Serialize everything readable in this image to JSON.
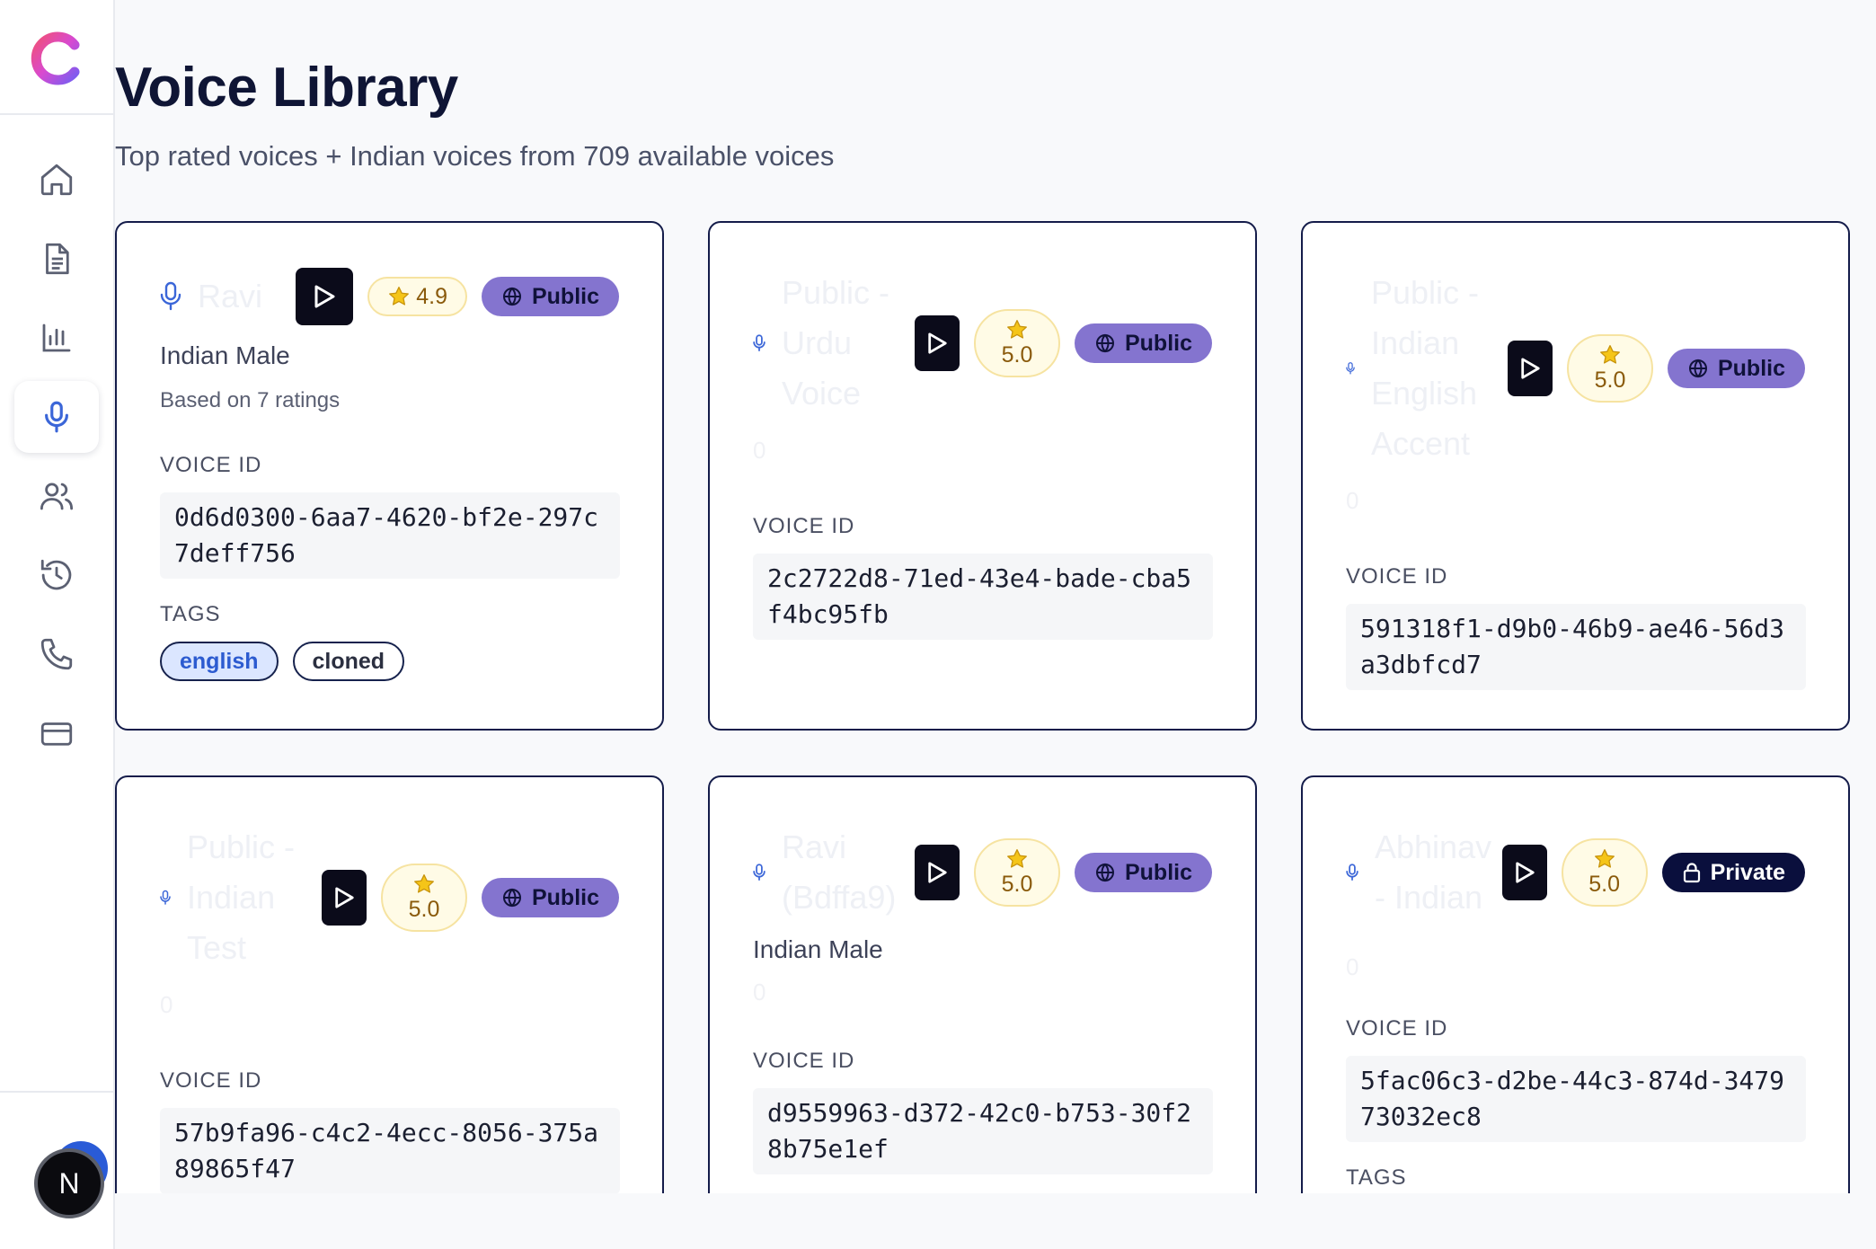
{
  "page": {
    "title": "Voice Library",
    "subtitle": "Top rated voices + Indian voices from 709 available voices"
  },
  "sidebar": {
    "items": [
      {
        "name": "home",
        "icon": "home-icon",
        "active": false
      },
      {
        "name": "documents",
        "icon": "document-icon",
        "active": false
      },
      {
        "name": "analytics",
        "icon": "bar-chart-icon",
        "active": false
      },
      {
        "name": "voices",
        "icon": "microphone-icon",
        "active": true
      },
      {
        "name": "users",
        "icon": "users-icon",
        "active": false
      },
      {
        "name": "history",
        "icon": "history-icon",
        "active": false
      },
      {
        "name": "calls",
        "icon": "phone-icon",
        "active": false
      },
      {
        "name": "billing",
        "icon": "credit-card-icon",
        "active": false
      }
    ],
    "user_initial": "N"
  },
  "labels": {
    "voice_id": "VOICE ID",
    "tags": "TAGS"
  },
  "cards": [
    {
      "name": "Ravi",
      "rating": "4.9",
      "visibility": "Public",
      "description": "Indian Male",
      "ratings_count": "Based on 7 ratings",
      "voice_id": "0d6d0300-6aa7-4620-bf2e-297c7deff756",
      "tags": [
        "english",
        "cloned"
      ]
    },
    {
      "name_lines": [
        "Public -",
        "Urdu",
        "Voice"
      ],
      "rating": "5.0",
      "visibility": "Public",
      "zero": "0",
      "voice_id": "2c2722d8-71ed-43e4-bade-cba5f4bc95fb"
    },
    {
      "name_lines": [
        "Public -",
        "Indian",
        "English",
        "Accent"
      ],
      "rating": "5.0",
      "visibility": "Public",
      "zero": "0",
      "voice_id": "591318f1-d9b0-46b9-ae46-56d3a3dbfcd7"
    },
    {
      "name_lines": [
        "Public -",
        "Indian",
        "Test"
      ],
      "rating": "5.0",
      "visibility": "Public",
      "zero": "0",
      "voice_id": "57b9fa96-c4c2-4ecc-8056-375a89865f47"
    },
    {
      "name_lines": [
        "Ravi",
        "(Bdffa9)"
      ],
      "rating": "5.0",
      "visibility": "Public",
      "description": "Indian Male",
      "zero": "0",
      "voice_id": "d9559963-d372-42c0-b753-30f28b75e1ef"
    },
    {
      "name_lines": [
        "Abhinav",
        "- Indian"
      ],
      "rating": "5.0",
      "visibility": "Private",
      "zero": "0",
      "voice_id": "5fac06c3-d2be-44c3-874d-347973032ec8"
    }
  ],
  "colors": {
    "accent_purple": "#8474cf",
    "private_navy": "#0a0f3d",
    "card_border": "#141c4a",
    "star_yellow": "#f5c518",
    "mic_blue": "#3b66d8"
  }
}
